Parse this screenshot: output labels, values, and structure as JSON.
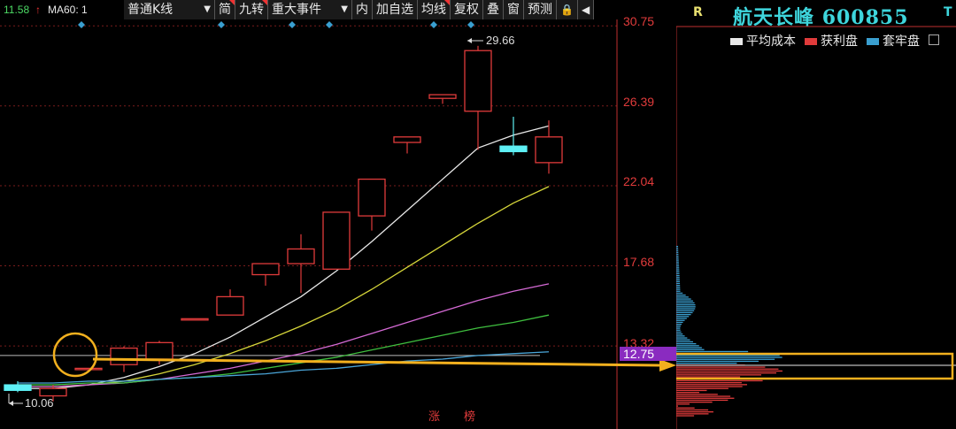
{
  "top": {
    "price_value": "11.58",
    "price_arrow": "↑",
    "ma60_label": "MA60: 1",
    "colors": {
      "price": "#4cd964",
      "arrow": "#e33",
      "ma60": "#e8e8e8"
    }
  },
  "toolbar": {
    "items": [
      {
        "label": "普通K线",
        "dropdown": "▼"
      },
      {
        "label": "简"
      },
      {
        "label": "九转"
      },
      {
        "label": "重大事件",
        "dropdown": "▼"
      },
      {
        "label": "内"
      },
      {
        "label": "加自选"
      },
      {
        "label": "均线"
      },
      {
        "label": "复权"
      },
      {
        "label": "叠"
      },
      {
        "label": "窗"
      },
      {
        "label": "预测"
      },
      {
        "label": "🔒"
      },
      {
        "label": "◀"
      }
    ]
  },
  "axis": {
    "labels": [
      "30.75",
      "26.39",
      "22.04",
      "17.68",
      "13.32"
    ],
    "current_price": "12.75",
    "high_marker": "29.66",
    "low_marker": "10.06"
  },
  "bottom_labels": [
    "涨",
    "榜"
  ],
  "side": {
    "r_label": "R",
    "stock_name": "航天长峰",
    "stock_code": "600855",
    "t_label": "T",
    "legend": [
      {
        "label": "平均成本",
        "color": "#e8e8e8"
      },
      {
        "label": "获利盘",
        "color": "#e03b3b"
      },
      {
        "label": "套牢盘",
        "color": "#3a9fd0"
      }
    ]
  },
  "chart_data": {
    "type": "candlestick",
    "ylim": [
      10,
      31
    ],
    "candles": [
      {
        "o": 11.2,
        "c": 10.9,
        "h": 11.4,
        "l": 10.8
      },
      {
        "o": 10.6,
        "c": 11.0,
        "h": 11.2,
        "l": 10.3
      },
      {
        "o": 12.1,
        "c": 12.1,
        "h": 12.1,
        "l": 12.1
      },
      {
        "o": 12.3,
        "c": 13.2,
        "h": 13.3,
        "l": 11.9
      },
      {
        "o": 12.6,
        "c": 13.5,
        "h": 13.6,
        "l": 12.3
      },
      {
        "o": 14.8,
        "c": 14.8,
        "h": 14.8,
        "l": 14.8
      },
      {
        "o": 15.0,
        "c": 16.0,
        "h": 16.4,
        "l": 15.0
      },
      {
        "o": 17.2,
        "c": 17.8,
        "h": 17.8,
        "l": 16.6
      },
      {
        "o": 17.8,
        "c": 18.6,
        "h": 19.4,
        "l": 16.2
      },
      {
        "o": 17.5,
        "c": 20.6,
        "h": 20.6,
        "l": 17.5
      },
      {
        "o": 20.4,
        "c": 22.4,
        "h": 22.4,
        "l": 19.6
      },
      {
        "o": 24.4,
        "c": 24.7,
        "h": 24.7,
        "l": 23.8
      },
      {
        "o": 26.8,
        "c": 27.0,
        "h": 27.0,
        "l": 26.5
      },
      {
        "o": 26.1,
        "c": 29.4,
        "h": 29.66,
        "l": 24.0
      },
      {
        "o": 24.2,
        "c": 23.9,
        "h": 25.8,
        "l": 23.7
      },
      {
        "o": 23.3,
        "c": 24.7,
        "h": 25.6,
        "l": 22.7
      }
    ],
    "ma_lines": [
      {
        "color": "#e8e8e8",
        "values": [
          11.0,
          11.0,
          11.2,
          11.6,
          12.2,
          12.9,
          13.8,
          14.9,
          16.0,
          17.4,
          19.0,
          20.7,
          22.4,
          24.1,
          24.8,
          25.3
        ]
      },
      {
        "color": "#d6d63a",
        "values": [
          11.1,
          11.1,
          11.2,
          11.4,
          11.8,
          12.3,
          12.9,
          13.6,
          14.4,
          15.3,
          16.4,
          17.6,
          18.8,
          20.0,
          21.1,
          22.0
        ]
      },
      {
        "color": "#d56ad5",
        "values": [
          11.1,
          11.1,
          11.2,
          11.3,
          11.5,
          11.8,
          12.1,
          12.5,
          12.9,
          13.4,
          14.0,
          14.6,
          15.2,
          15.8,
          16.3,
          16.7
        ]
      },
      {
        "color": "#3fbf3f",
        "values": [
          11.2,
          11.2,
          11.3,
          11.3,
          11.5,
          11.6,
          11.8,
          12.1,
          12.4,
          12.7,
          13.1,
          13.5,
          13.9,
          14.3,
          14.6,
          15.0
        ]
      },
      {
        "color": "#4aa5d8",
        "values": [
          11.3,
          11.3,
          11.4,
          11.4,
          11.5,
          11.6,
          11.7,
          11.8,
          12.0,
          12.1,
          12.3,
          12.5,
          12.6,
          12.8,
          12.9,
          13.0
        ]
      }
    ],
    "flat_line": 12.8
  }
}
